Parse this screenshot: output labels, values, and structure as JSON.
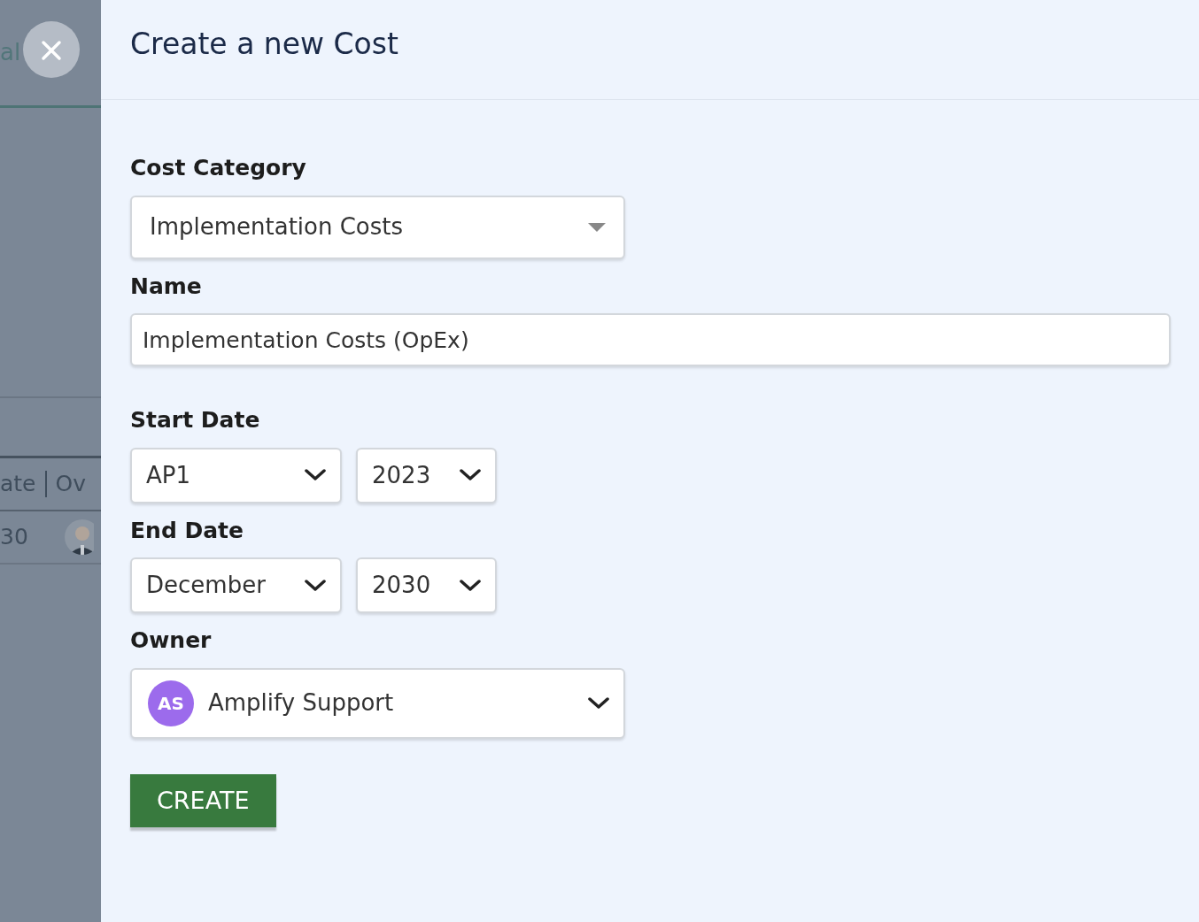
{
  "background": {
    "heading_fragment": "al",
    "columns": [
      "ate",
      "Ov"
    ],
    "cell": "30"
  },
  "title": "Create a new Cost",
  "fields": [
    {
      "kind": "dropdown",
      "label": "Cost Category",
      "value": "Implementation Costs"
    },
    {
      "kind": "text",
      "label": "Name",
      "value": "Implementation Costs (OpEx)"
    },
    {
      "kind": "period",
      "label": "Start Date",
      "month": "AP1",
      "year": "2023"
    },
    {
      "kind": "period",
      "label": "End Date",
      "month": "December",
      "year": "2030"
    },
    {
      "kind": "person",
      "label": "Owner",
      "initials": "AS",
      "color": "#9c6bec",
      "value": "Amplify Support"
    }
  ],
  "submit": "CREATE"
}
